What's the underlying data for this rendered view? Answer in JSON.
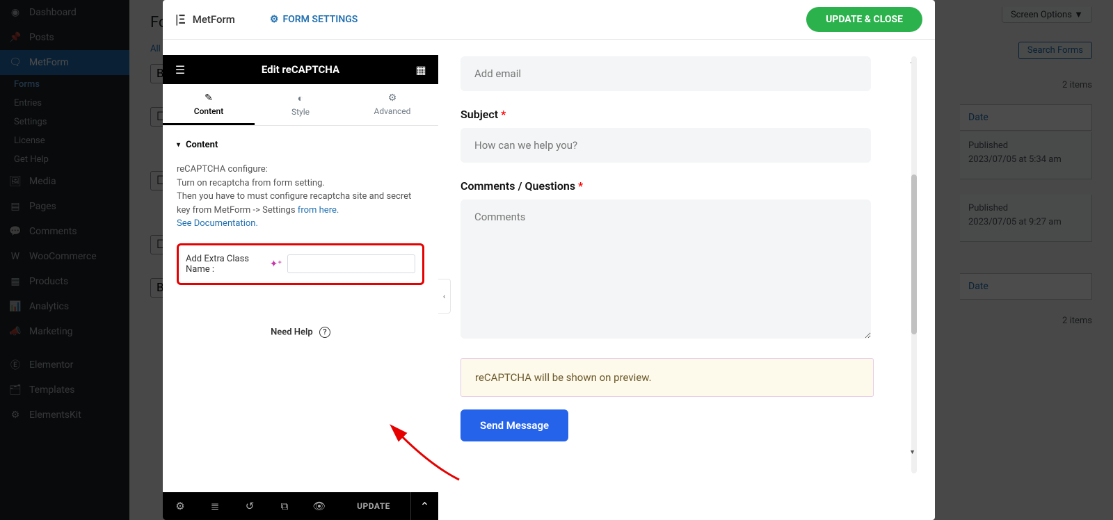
{
  "wpSidebar": {
    "dashboard": "Dashboard",
    "posts": "Posts",
    "metform": "MetForm",
    "forms": "Forms",
    "entries": "Entries",
    "settings": "Settings",
    "license": "License",
    "gethelp": "Get Help",
    "media": "Media",
    "pages": "Pages",
    "comments": "Comments",
    "woocommerce": "WooCommerce",
    "products": "Products",
    "analytics": "Analytics",
    "marketing": "Marketing",
    "elementor": "Elementor",
    "templates": "Templates",
    "elementskit": "ElementsKit"
  },
  "bgPage": {
    "title": "Fo",
    "all": "All",
    "screenOptions": "Screen Options",
    "searchForms": "Search Forms",
    "itemsCount": "2 items",
    "dateH": "Date",
    "row1a": "Published",
    "row1b": "2023/07/05 at 5:34 am",
    "row2a": "Published",
    "row2b": "2023/07/05 at 9:27 am",
    "bcheck": "B"
  },
  "modal": {
    "brand": "MetForm",
    "formSettings": "FORM SETTINGS",
    "updateClose": "UPDATE & CLOSE"
  },
  "elPanel": {
    "title": "Edit reCAPTCHA",
    "tabContent": "Content",
    "tabStyle": "Style",
    "tabAdvanced": "Advanced",
    "sectionTitle": "Content",
    "configLine1": "reCAPTCHA configure:",
    "configLine2": "Turn on recaptcha from form setting.",
    "configLine3a": "Then you have to must configure recaptcha site and secret key from MetForm -> Settings ",
    "configLine3b": "from here.",
    "seeDoc": "See Documentation.",
    "extraClassLabel": "Add Extra Class Name :",
    "needHelp": "Need Help",
    "footerUpdate": "UPDATE"
  },
  "preview": {
    "emailPH": "Add email",
    "subjectLabel": "Subject",
    "subjectPH": "How can we help you?",
    "commentsLabel": "Comments / Questions",
    "commentsPH": "Comments",
    "recaptchaNotice": "reCAPTCHA will be shown on preview.",
    "sendBtn": "Send Message"
  }
}
